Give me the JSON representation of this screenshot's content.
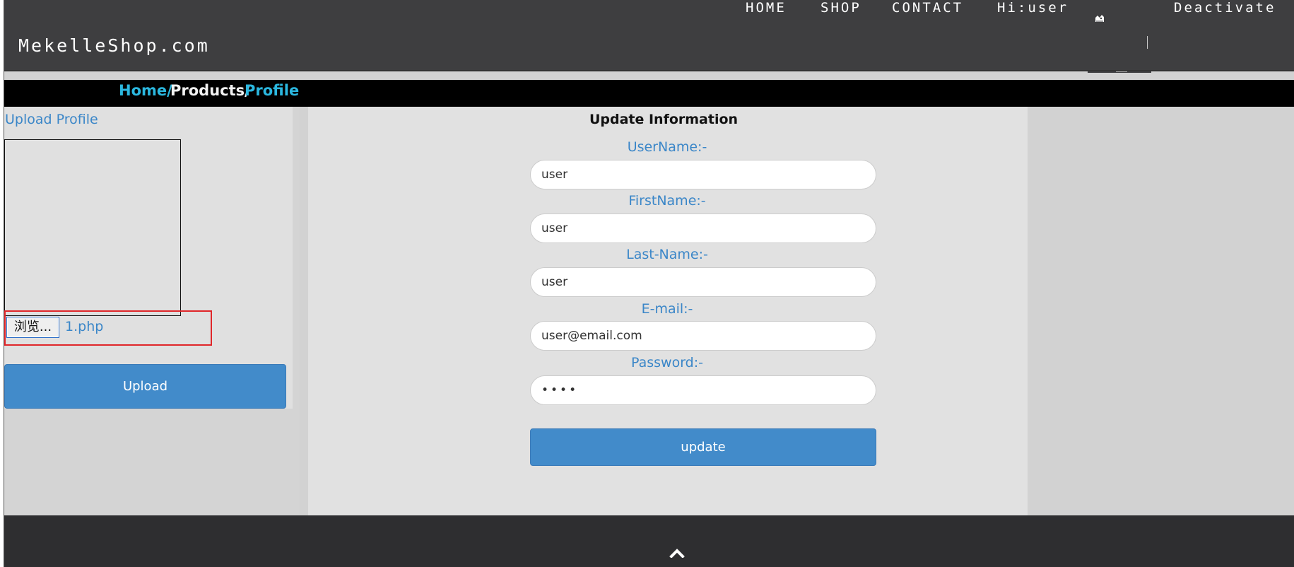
{
  "header": {
    "logo": "MekelleShop.com",
    "nav": [
      {
        "label": "HOME"
      },
      {
        "label": "SHOP"
      },
      {
        "label": "CONTACT"
      },
      {
        "label": "Hi:user"
      },
      {
        "label": "Deactivate"
      }
    ]
  },
  "breadcrumb": {
    "home": "Home/",
    "products": "Products/",
    "profile": "Profile"
  },
  "upload": {
    "title": "Upload Profile",
    "browse_label": "浏览...",
    "file_name": "1.php",
    "button_label": "Upload"
  },
  "form": {
    "title": "Update Information",
    "fields": [
      {
        "label": "UserName:-",
        "value": "user"
      },
      {
        "label": "FirstName:-",
        "value": "user"
      },
      {
        "label": "Last-Name:-",
        "value": "user"
      },
      {
        "label": "E-mail:-",
        "value": "user@email.com"
      },
      {
        "label": "Password:-",
        "value": "••••"
      }
    ],
    "button_label": "update"
  },
  "colors": {
    "header_bg": "#3e3e40",
    "accent_blue": "#428bca",
    "label_blue": "#3a86c8",
    "breadcrumb_blue": "#2bb8e0",
    "highlight_red": "#e0262a"
  }
}
